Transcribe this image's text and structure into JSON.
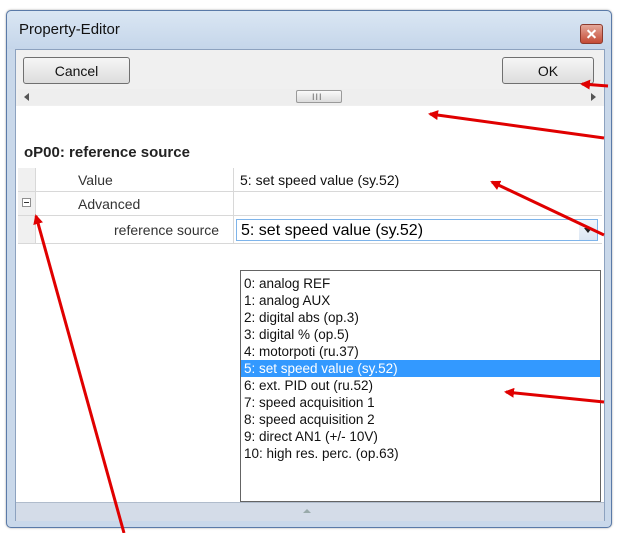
{
  "window": {
    "title": "Property-Editor"
  },
  "toolbar": {
    "cancel_label": "Cancel",
    "ok_label": "OK"
  },
  "scrollbar": {
    "thumb_grip": "III"
  },
  "section": {
    "title": "oP00: reference source"
  },
  "grid": {
    "value_label": "Value",
    "value": "5: set speed value (sy.52)",
    "advanced_label": "Advanced",
    "reference_label": "reference source",
    "reference_value": "5: set speed value (sy.52)"
  },
  "dropdown": {
    "selected_index": 5,
    "options": [
      "0: analog REF",
      "1: analog AUX",
      "2: digital abs (op.3)",
      "3: digital % (op.5)",
      "4: motorpoti (ru.37)",
      "5: set speed value (sy.52)",
      "6: ext. PID out (ru.52)",
      "7: speed acquisition 1",
      "8: speed acquisition 2",
      "9: direct AN1 (+/- 10V)",
      "10: high res. perc. (op.63)"
    ]
  },
  "colors": {
    "selection": "#3399ff",
    "annotation_arrow": "#e00000",
    "close_button": "#c44a35"
  },
  "icons": {
    "close": "close-icon",
    "expander": "collapse-minus-icon",
    "combo_arrow": "chevron-down-icon",
    "scroll_left": "arrow-left-icon",
    "scroll_right": "arrow-right-icon"
  }
}
